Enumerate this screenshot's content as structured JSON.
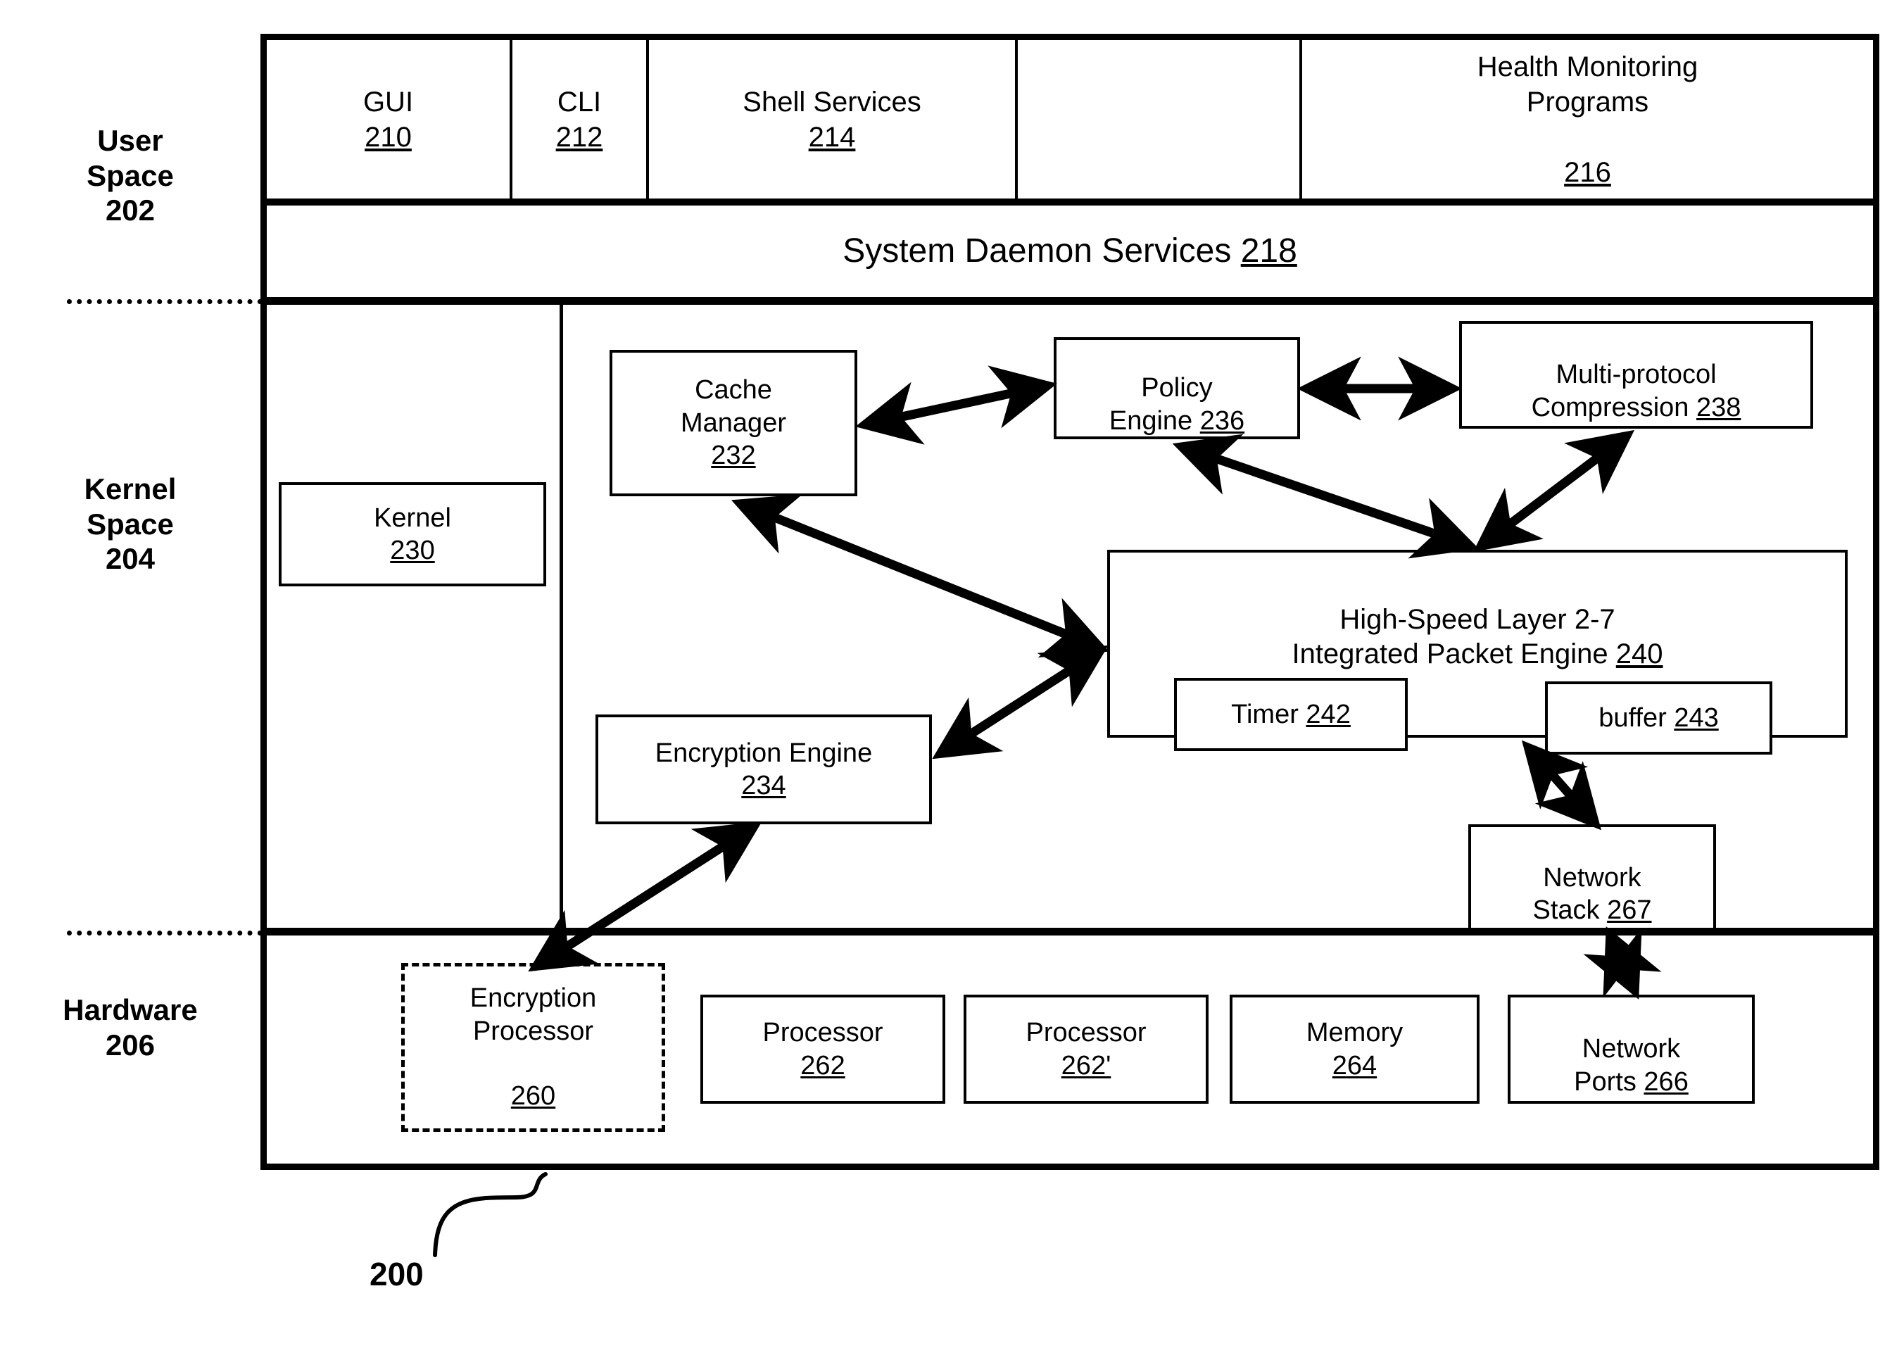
{
  "figure": {
    "number": "200",
    "regions": [
      {
        "name": "user_space",
        "label": "User\nSpace\n202"
      },
      {
        "name": "kernel_space",
        "label": "Kernel\nSpace\n204"
      },
      {
        "name": "hardware",
        "label": "Hardware\n206"
      }
    ]
  },
  "user_space": {
    "cells": [
      {
        "title": "GUI",
        "ref": "210",
        "two_line": true
      },
      {
        "title": "CLI",
        "ref": "212",
        "two_line": true
      },
      {
        "title": "Shell Services",
        "ref": "214",
        "two_line": true
      },
      {
        "title": "",
        "ref": "",
        "two_line": false
      },
      {
        "title": "Health Monitoring\nPrograms",
        "ref": "216",
        "two_line": true
      }
    ],
    "daemon_row": {
      "title": "System Daemon Services",
      "ref": "218"
    }
  },
  "kernel_space": {
    "boxes": [
      {
        "name": "kernel",
        "title": "Kernel",
        "ref": "230",
        "inline_ref": false
      },
      {
        "name": "cache-manager",
        "title": "Cache\nManager",
        "ref": "232",
        "inline_ref": false
      },
      {
        "name": "encryption-engine",
        "title": "Encryption Engine",
        "ref": "234",
        "inline_ref": false
      },
      {
        "name": "policy-engine",
        "title": "Policy\nEngine",
        "ref": "236",
        "inline_ref": true
      },
      {
        "name": "multi-protocol-compression",
        "title": "Multi-protocol\nCompression",
        "ref": "238",
        "inline_ref": true
      },
      {
        "name": "packet-engine",
        "title": "High-Speed Layer 2-7\nIntegrated Packet Engine",
        "ref": "240",
        "inline_ref": true
      },
      {
        "name": "timer",
        "title": "Timer",
        "ref": "242",
        "inline_ref": true
      },
      {
        "name": "buffer",
        "title": "buffer",
        "ref": "243",
        "inline_ref": true
      },
      {
        "name": "network-stack",
        "title": "Network\nStack",
        "ref": "267",
        "inline_ref": true
      }
    ]
  },
  "hardware": {
    "boxes": [
      {
        "name": "encryption-processor",
        "title": "Encryption\nProcessor",
        "ref": "260",
        "dashed": true,
        "inline_ref": false
      },
      {
        "name": "processor-262",
        "title": "Processor",
        "ref": "262",
        "dashed": false,
        "inline_ref": false
      },
      {
        "name": "processor-262-prime",
        "title": "Processor",
        "ref": "262'",
        "dashed": false,
        "inline_ref": false
      },
      {
        "name": "memory",
        "title": "Memory",
        "ref": "264",
        "dashed": false,
        "inline_ref": false
      },
      {
        "name": "network-ports",
        "title": "Network\nPorts",
        "ref": "266",
        "dashed": false,
        "inline_ref": true
      }
    ]
  },
  "connections": [
    {
      "from": "cache-manager",
      "to": "policy-engine",
      "style": "double-arrow"
    },
    {
      "from": "policy-engine",
      "to": "multi-protocol-compression",
      "style": "double-arrow"
    },
    {
      "from": "policy-engine",
      "to": "packet-engine",
      "style": "double-arrow"
    },
    {
      "from": "multi-protocol-compression",
      "to": "packet-engine",
      "style": "double-arrow"
    },
    {
      "from": "cache-manager",
      "to": "packet-engine",
      "style": "double-arrow"
    },
    {
      "from": "encryption-engine",
      "to": "packet-engine",
      "style": "double-arrow"
    },
    {
      "from": "encryption-engine",
      "to": "encryption-processor",
      "style": "double-arrow"
    },
    {
      "from": "buffer",
      "to": "network-stack",
      "style": "double-arrow"
    },
    {
      "from": "network-stack",
      "to": "network-ports",
      "style": "double-arrow"
    }
  ],
  "colors": {
    "ink": "#000000",
    "paper": "#ffffff"
  }
}
